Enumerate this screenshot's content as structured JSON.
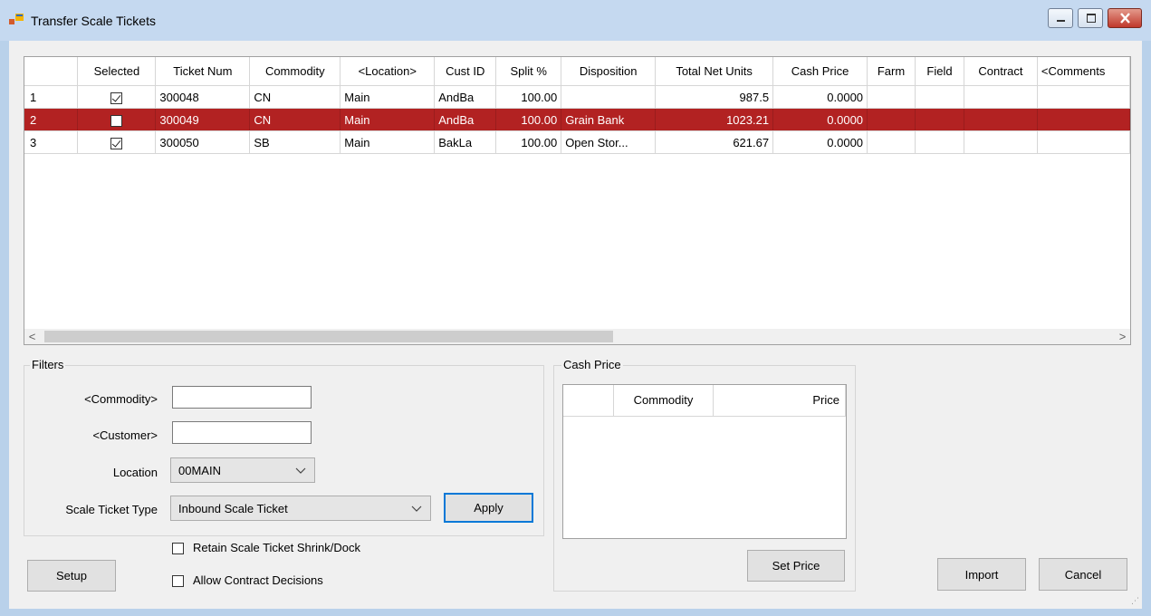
{
  "window": {
    "title": "Transfer Scale Tickets"
  },
  "grid": {
    "columns": [
      "Selected",
      "Ticket Num",
      "Commodity",
      "<Location>",
      "Cust ID",
      "Split %",
      "Disposition",
      "Total Net Units",
      "Cash Price",
      "Farm",
      "Field",
      "Contract",
      "<Comments"
    ],
    "rows": [
      {
        "row": "1",
        "selected": true,
        "ticket": "300048",
        "commodity": "CN",
        "location": "Main",
        "cust": "AndBa",
        "split": "100.00",
        "disposition": "",
        "units": "987.5",
        "cash": "0.0000",
        "farm": "",
        "field": "",
        "contract": "",
        "comments": "",
        "highlighted": false
      },
      {
        "row": "2",
        "selected": false,
        "ticket": "300049",
        "commodity": "CN",
        "location": "Main",
        "cust": "AndBa",
        "split": "100.00",
        "disposition": "Grain Bank",
        "units": "1023.21",
        "cash": "0.0000",
        "farm": "",
        "field": "",
        "contract": "",
        "comments": "",
        "highlighted": true
      },
      {
        "row": "3",
        "selected": true,
        "ticket": "300050",
        "commodity": "SB",
        "location": "Main",
        "cust": "BakLa",
        "split": "100.00",
        "disposition": "Open Stor...",
        "units": "621.67",
        "cash": "0.0000",
        "farm": "",
        "field": "",
        "contract": "",
        "comments": "",
        "highlighted": false
      }
    ],
    "highlight_color": "#b22222",
    "scroll_left_icon": "<",
    "scroll_right_icon": ">"
  },
  "filters": {
    "title": "Filters",
    "commodity_label": "<Commodity>",
    "commodity_value": "",
    "customer_label": "<Customer>",
    "customer_value": "",
    "location_label": "Location",
    "location_value": "00MAIN",
    "ticket_type_label": "Scale Ticket Type",
    "ticket_type_value": "Inbound Scale Ticket",
    "apply_label": "Apply"
  },
  "options": {
    "retain_label": "Retain Scale Ticket Shrink/Dock",
    "retain_checked": false,
    "allow_label": "Allow Contract Decisions",
    "allow_checked": false
  },
  "cash_price": {
    "title": "Cash Price",
    "col_commodity": "Commodity",
    "col_price": "Price",
    "set_price_label": "Set Price"
  },
  "buttons": {
    "setup": "Setup",
    "import": "Import",
    "cancel": "Cancel"
  }
}
